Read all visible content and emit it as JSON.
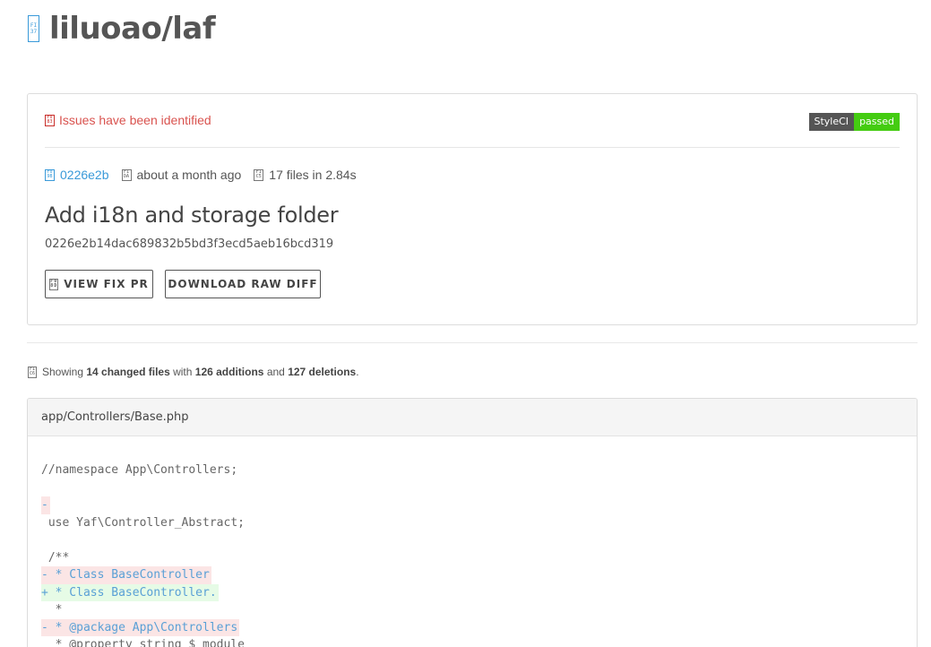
{
  "header": {
    "repo_icon": "file-code-icon",
    "repo_name": "liluoao/laf"
  },
  "status": {
    "icon": "alert-icon",
    "message": "Issues have been identified",
    "badge_label": "StyleCI",
    "badge_value": "passed",
    "colors": {
      "error": "#d9534f",
      "badge_dark": "#555555",
      "badge_green": "#44cc11",
      "link": "#3a9ad9"
    }
  },
  "commit": {
    "short_sha": "0226e2b",
    "time": "about a month ago",
    "files_info": "17 files in 2.84s",
    "title": "Add i18n and storage folder",
    "full_sha": "0226e2b14dac689832b5bd3f3ecd5aeb16bcd319"
  },
  "actions": {
    "view_fix_pr": "VIEW FIX PR",
    "download_raw_diff": "DOWNLOAD RAW DIFF"
  },
  "summary": {
    "prefix": "Showing",
    "changed_files": "14 changed files",
    "with": "with",
    "additions": "126 additions",
    "and": "and",
    "deletions": "127 deletions",
    "suffix": "."
  },
  "file": {
    "path": "app/Controllers/Base.php",
    "lines": [
      {
        "type": "ctx",
        "text": "//namespace App\\Controllers;"
      },
      {
        "type": "blank",
        "text": ""
      },
      {
        "type": "del",
        "text": "-"
      },
      {
        "type": "ctx",
        "text": " use Yaf\\Controller_Abstract;"
      },
      {
        "type": "blank",
        "text": ""
      },
      {
        "type": "ctx",
        "text": " /**"
      },
      {
        "type": "del",
        "text": "- * Class BaseController"
      },
      {
        "type": "add",
        "text": "+ * Class BaseController."
      },
      {
        "type": "ctx",
        "text": "  *"
      },
      {
        "type": "del",
        "text": "- * @package App\\Controllers"
      },
      {
        "type": "ctx",
        "text": "  * @property string $ module"
      }
    ]
  }
}
